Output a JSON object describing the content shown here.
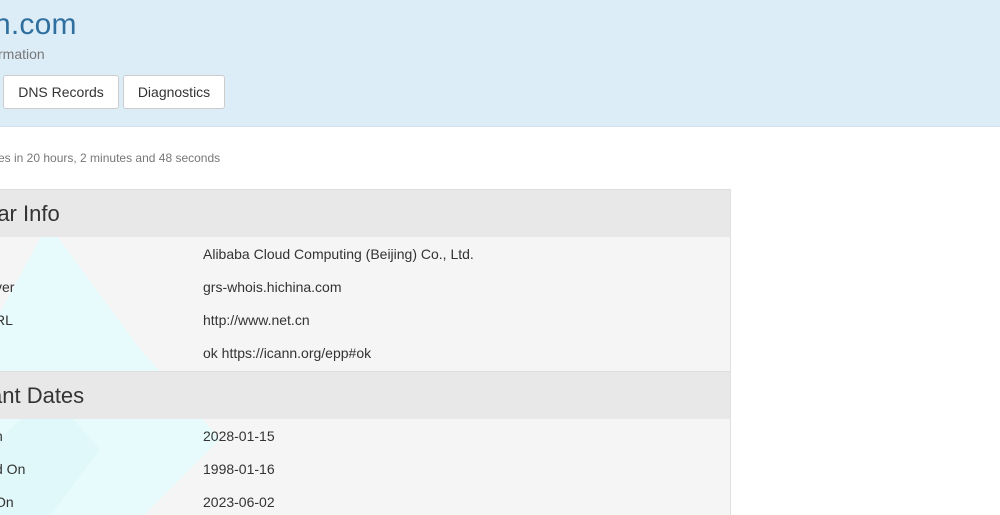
{
  "header": {
    "domain_title": "n.com",
    "subtitle": "rmation",
    "tabs": [
      {
        "label": "DNS Records"
      },
      {
        "label": "Diagnostics"
      }
    ]
  },
  "cache_note": "es in 20 hours, 2 minutes and 48 seconds",
  "sections": [
    {
      "title": "rar Info",
      "rows": [
        {
          "key": "",
          "value": "Alibaba Cloud Computing (Beijing) Co., Ltd."
        },
        {
          "key": "ver",
          "value": "grs-whois.hichina.com"
        },
        {
          "key": "RL",
          "value": "http://www.net.cn"
        },
        {
          "key": "",
          "value": "ok https://icann.org/epp#ok"
        }
      ]
    },
    {
      "title": "ant Dates",
      "rows": [
        {
          "key": "n",
          "value": "2028-01-15"
        },
        {
          "key": "d On",
          "value": "1998-01-16"
        },
        {
          "key": "On",
          "value": "2023-06-02"
        }
      ]
    }
  ]
}
